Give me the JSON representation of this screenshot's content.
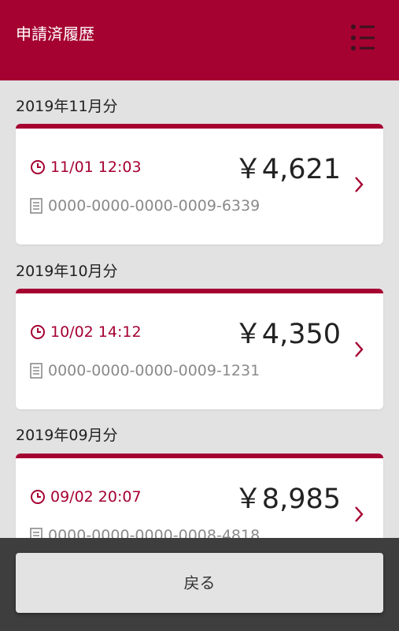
{
  "header": {
    "title": "申請済履歴",
    "menu_icon": "list-menu-icon"
  },
  "months": [
    {
      "label": "2019年11月分",
      "time": "11/01 12:03",
      "amount": "￥4,621",
      "number": "0000-0000-0000-0009-6339"
    },
    {
      "label": "2019年10月分",
      "time": "10/02 14:12",
      "amount": "￥4,350",
      "number": "0000-0000-0000-0009-1231"
    },
    {
      "label": "2019年09月分",
      "time": "09/02 20:07",
      "amount": "￥8,985",
      "number": "0000-0000-0000-0008-4818"
    }
  ],
  "footer": {
    "back_label": "戻る"
  },
  "colors": {
    "brand": "#a50131",
    "background": "#e2e2e2",
    "footer": "#3e3e3e"
  }
}
